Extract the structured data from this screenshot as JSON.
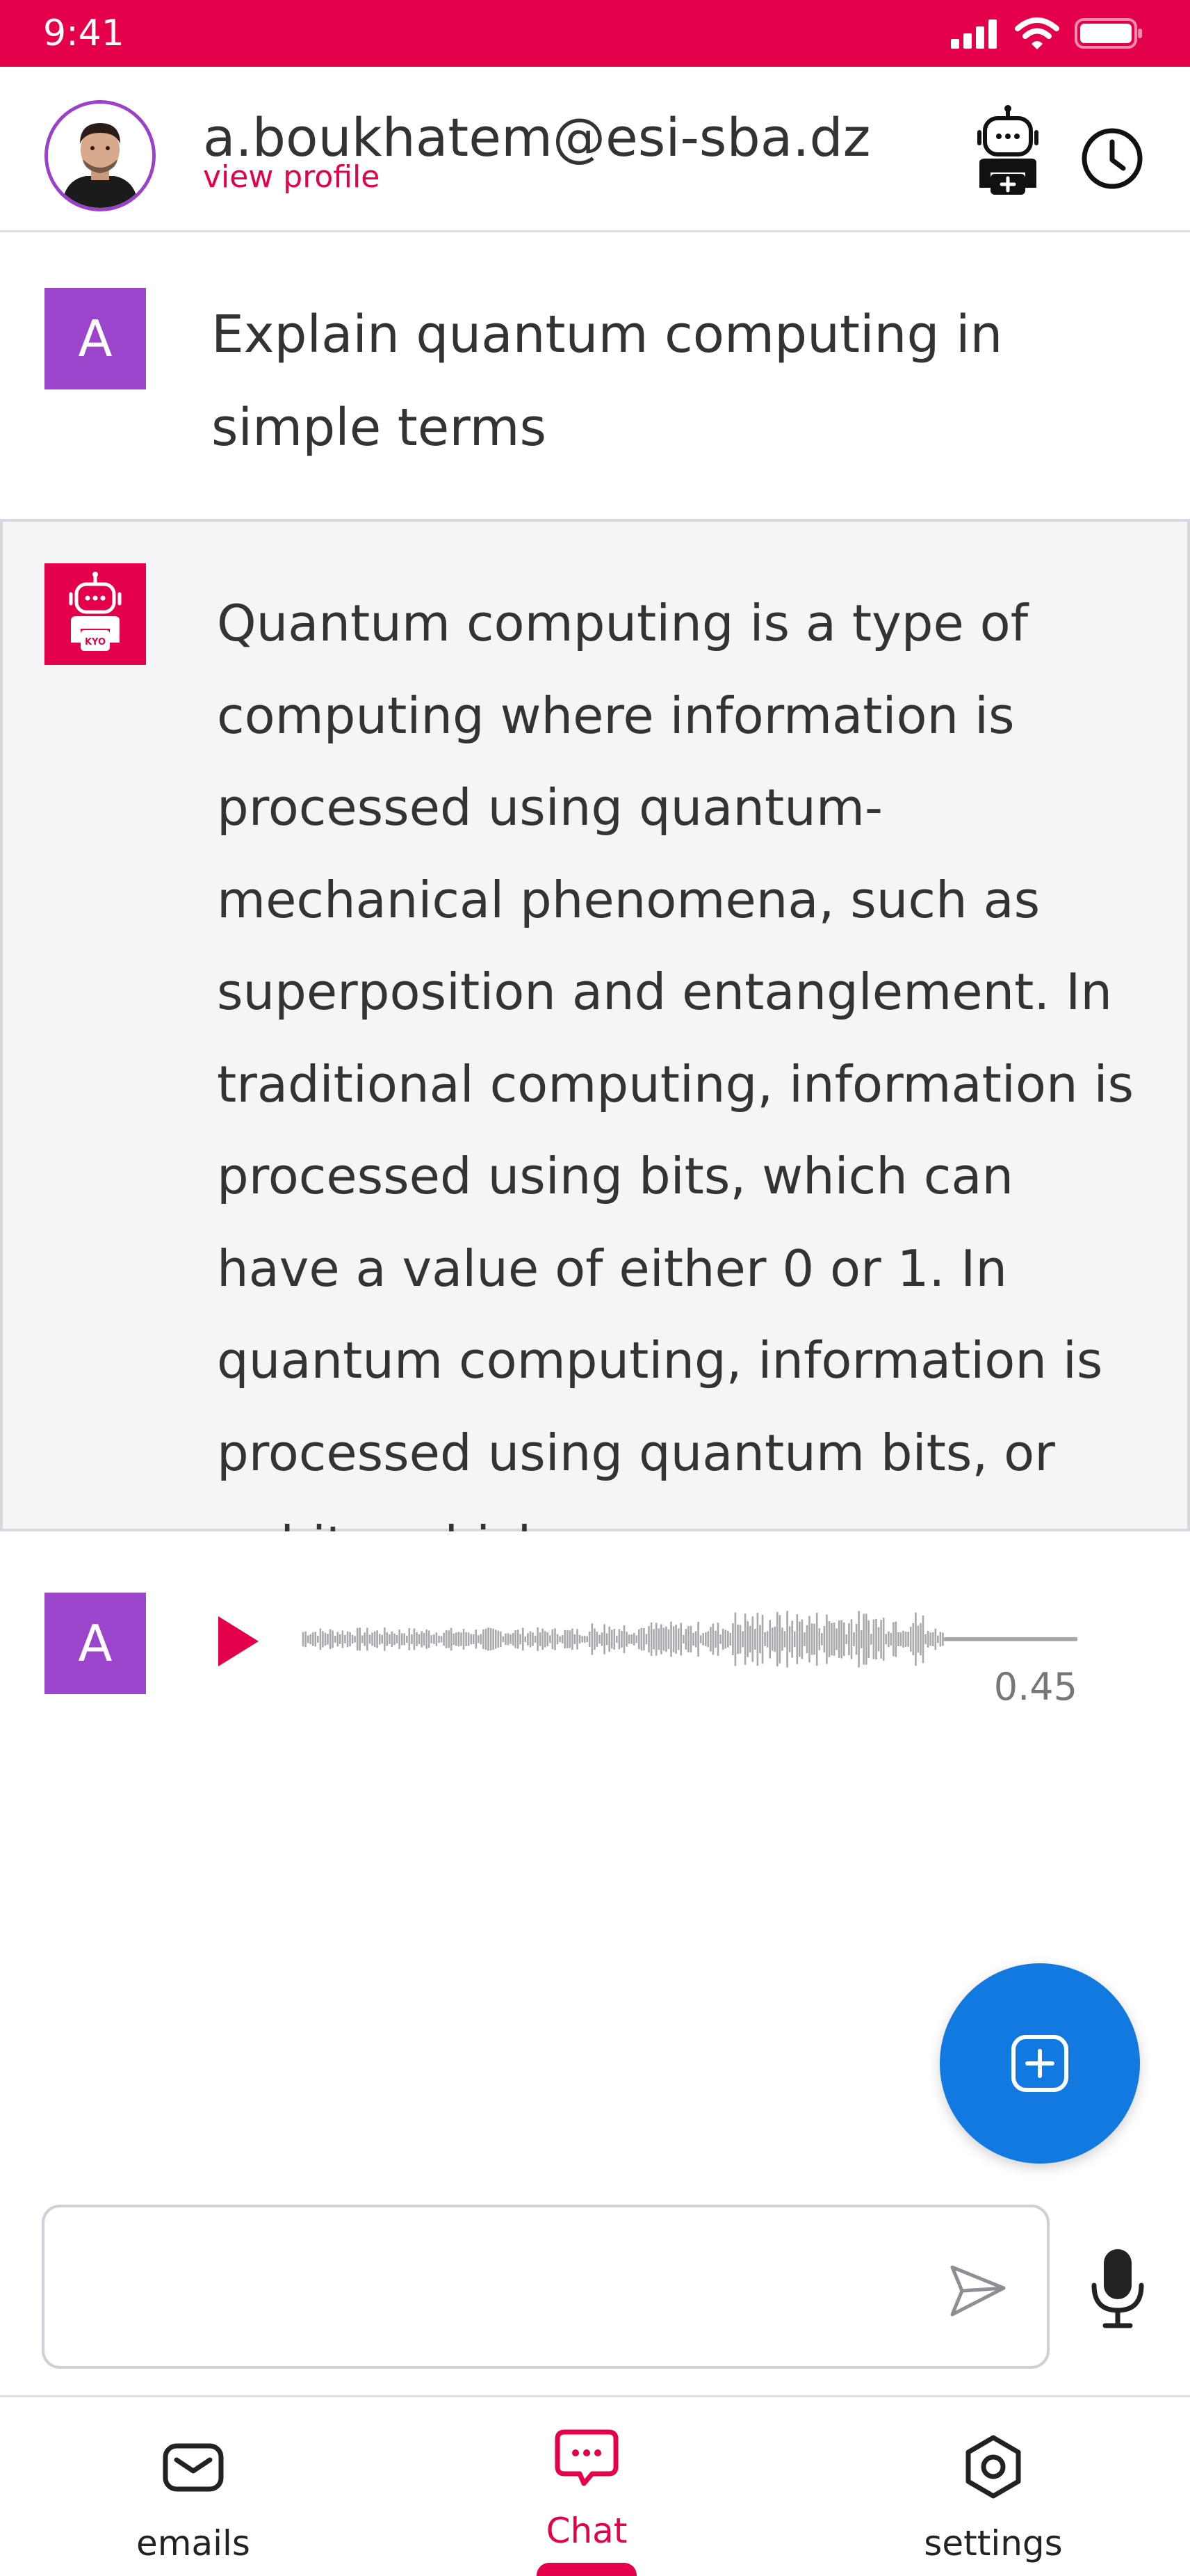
{
  "status_bar": {
    "time": "9:41",
    "icons": [
      "signal-icon",
      "wifi-icon",
      "battery-icon"
    ],
    "background": "#E4004B"
  },
  "header": {
    "email": "a.boukhatem@esi-sba.dz",
    "view_profile": "view profile",
    "actions": [
      "new-bot-chat-icon",
      "history-icon"
    ]
  },
  "conversation": {
    "user_message": {
      "avatar_letter": "A",
      "text": "Explain quantum computing in simple terms"
    },
    "bot_message": {
      "avatar_label": "KYO",
      "text": "Quantum computing is a type of computing where information is processed using quantum-mechanical phenomena, such as superposition and entanglement. In traditional computing, information is processed using bits, which can have a value of either 0 or 1. In quantum computing, information is processed using quantum bits, or qubits, which can"
    },
    "audio_message": {
      "avatar_letter": "A",
      "duration": "0.45",
      "progress_fraction": 0
    }
  },
  "composer": {
    "placeholder": "",
    "value": ""
  },
  "bottom_nav": {
    "items": [
      {
        "label": "emails",
        "icon": "mail-icon",
        "active": false
      },
      {
        "label": "Chat",
        "icon": "chat-icon",
        "active": true
      },
      {
        "label": "settings",
        "icon": "settings-icon",
        "active": false
      }
    ]
  },
  "colors": {
    "accent": "#E4004B",
    "avatar_purple": "#9B45CC",
    "fab_blue": "#1279E0",
    "bot_bubble_bg": "#F5F5F7"
  }
}
